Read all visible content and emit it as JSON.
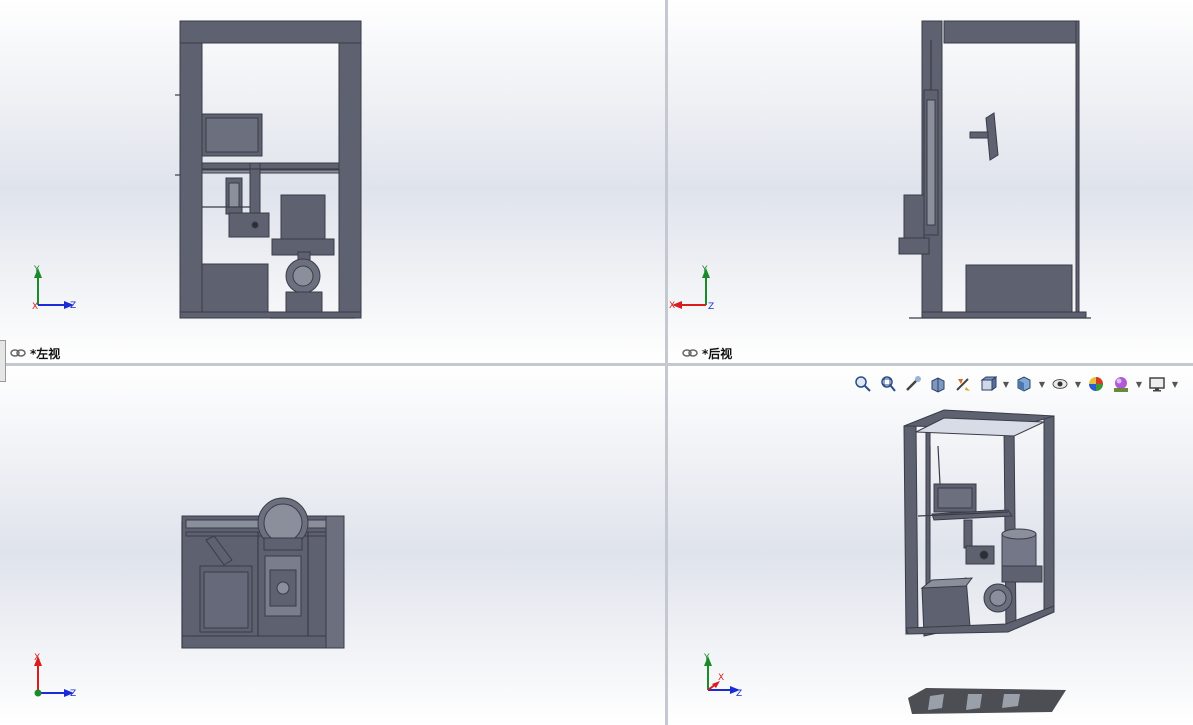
{
  "viewports": {
    "top_left": {
      "label": "*左视",
      "triad": {
        "x": "X",
        "y": "Y",
        "z": "Z"
      }
    },
    "top_right": {
      "label": "*后视",
      "triad": {
        "x": "X",
        "y": "Y",
        "z": "Z"
      }
    },
    "bottom_left": {
      "triad": {
        "x": "X",
        "z": "Z"
      }
    },
    "bottom_right": {
      "triad": {
        "x": "X",
        "y": "Y",
        "z": "Z"
      }
    }
  },
  "hud_toolbar": {
    "items": [
      "zoom-to-fit-icon",
      "zoom-to-area-icon",
      "previous-view-icon",
      "section-view-icon",
      "dynamic-annotation-icon",
      "view-orientation-icon",
      "display-style-icon",
      "hide-show-items-icon",
      "edit-appearance-icon",
      "apply-scene-icon",
      "view-settings-icon"
    ]
  },
  "colors": {
    "model_fill": "#5e6170",
    "model_dark": "#3a3c48",
    "model_light": "#8b8e9b",
    "axis_x": "#d81e1e",
    "axis_y": "#1a8a2a",
    "axis_z": "#1b2bd6",
    "divider": "#c4c8d0"
  }
}
